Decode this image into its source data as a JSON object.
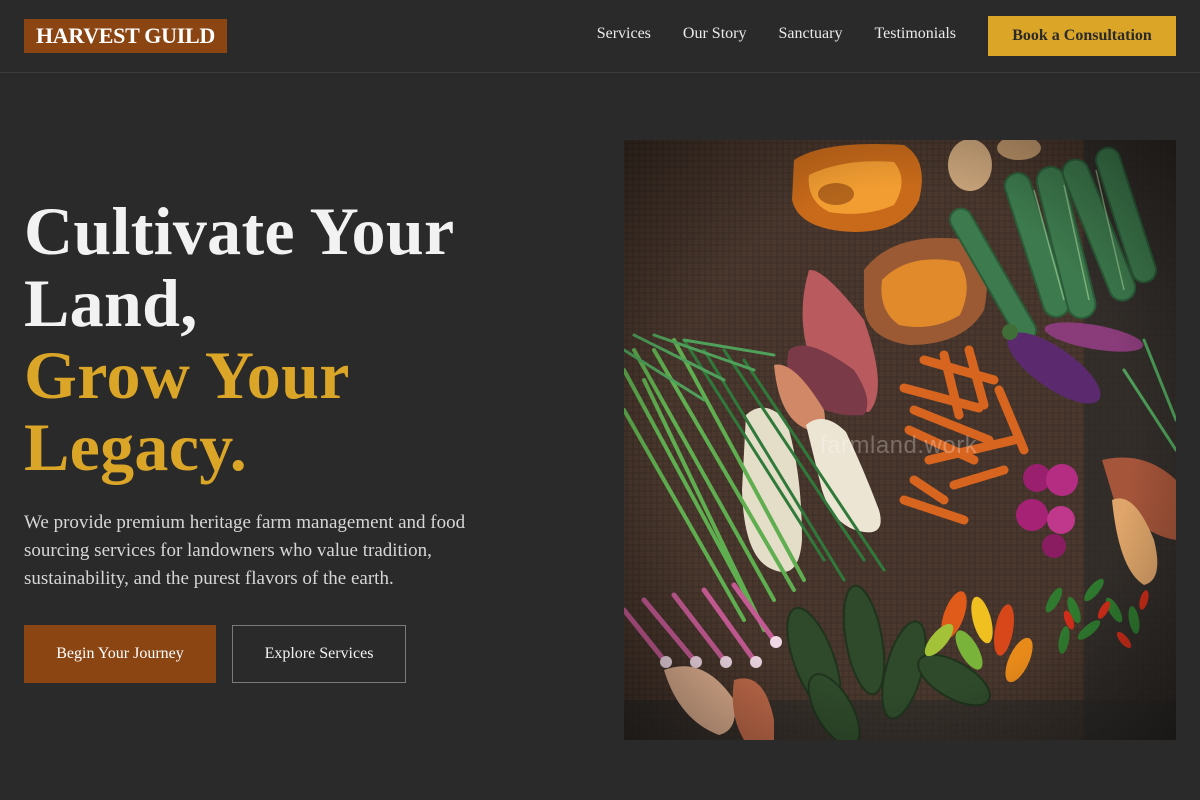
{
  "header": {
    "logo": "HARVEST GUILD",
    "nav": [
      {
        "label": "Services"
      },
      {
        "label": "Our Story"
      },
      {
        "label": "Sanctuary"
      },
      {
        "label": "Testimonials"
      }
    ],
    "cta_label": "Book a Consultation"
  },
  "hero": {
    "headline_line1": "Cultivate Your",
    "headline_line2": "Land,",
    "headline_line3": "Grow Your",
    "headline_line4": "Legacy.",
    "description": "We provide premium heritage farm management and food sourcing services for landowners who value tradition, sustainability, and the purest flavors of the earth.",
    "primary_button": "Begin Your Journey",
    "secondary_button": "Explore Services",
    "image_watermark": "farmland.work"
  },
  "colors": {
    "background": "#2a2a2a",
    "brand_brown": "#8b4513",
    "accent_gold": "#dba628"
  }
}
